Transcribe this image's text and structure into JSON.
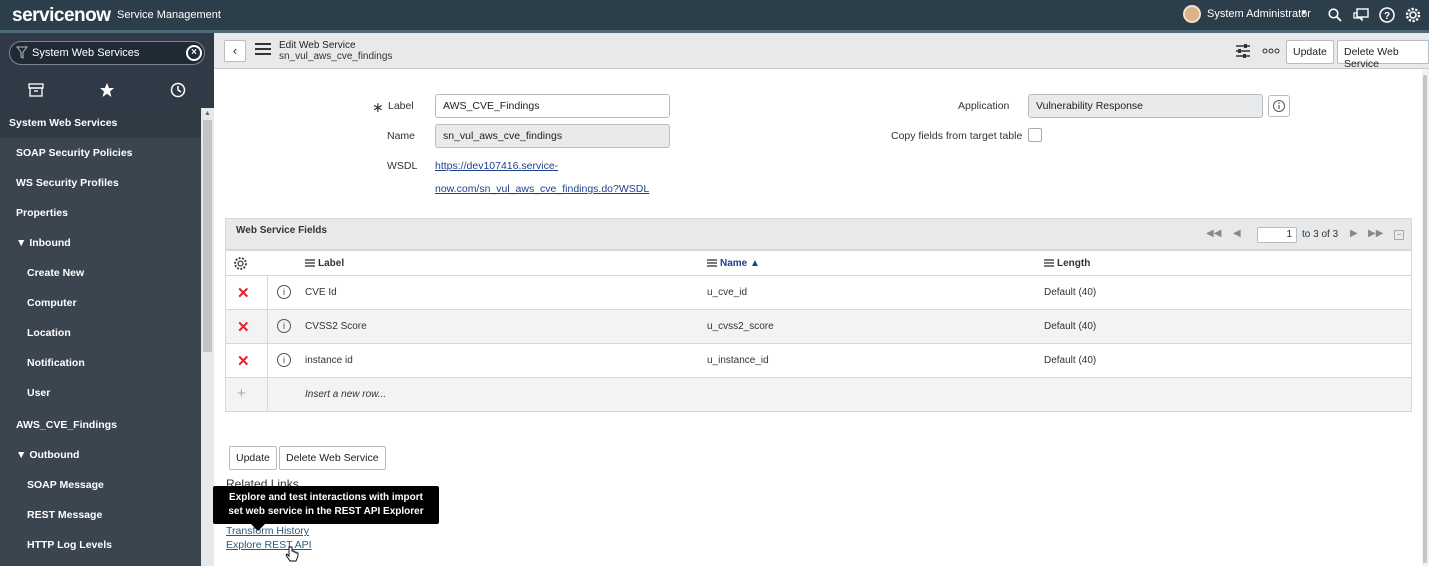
{
  "banner": {
    "logo_text": "servicenow",
    "product": "Service Management",
    "user_name": "System Administrator",
    "icons": [
      "search-icon",
      "chat-icon",
      "help-icon",
      "gear-icon"
    ]
  },
  "sidebar": {
    "filter_value": "System Web Services",
    "tabs": [
      "archive-icon",
      "star-icon",
      "history-icon"
    ],
    "items": [
      {
        "label": "System Web Services",
        "type": "header"
      },
      {
        "label": "SOAP Security Policies",
        "type": "item"
      },
      {
        "label": "WS Security Profiles",
        "type": "item"
      },
      {
        "label": "Properties",
        "type": "item"
      },
      {
        "label": "Inbound",
        "type": "section"
      },
      {
        "label": "Create New",
        "type": "subitem"
      },
      {
        "label": "Computer",
        "type": "subitem"
      },
      {
        "label": "Location",
        "type": "subitem"
      },
      {
        "label": "Notification",
        "type": "subitem"
      },
      {
        "label": "User",
        "type": "subitem"
      },
      {
        "label": "AWS_CVE_Findings",
        "type": "item"
      },
      {
        "label": "Outbound",
        "type": "section"
      },
      {
        "label": "SOAP Message",
        "type": "subitem"
      },
      {
        "label": "REST Message",
        "type": "subitem"
      },
      {
        "label": "HTTP Log Levels",
        "type": "subitem"
      }
    ]
  },
  "header": {
    "title": "Edit Web Service",
    "subtitle": "sn_vul_aws_cve_findings",
    "update_label": "Update",
    "delete_label": "Delete Web Service"
  },
  "form": {
    "label_label": "Label",
    "label_value": "AWS_CVE_Findings",
    "name_label": "Name",
    "name_value": "sn_vul_aws_cve_findings",
    "wsdl_label": "WSDL",
    "wsdl_line1": "https://dev107416.service-",
    "wsdl_line2": "now.com/sn_vul_aws_cve_findings.do?WSDL",
    "application_label": "Application",
    "application_value": "Vulnerability Response",
    "copy_fields_label": "Copy fields from target table"
  },
  "related_list": {
    "title": "Web Service Fields",
    "page_value": "1",
    "page_text": "to 3 of 3",
    "columns": [
      "Label",
      "Name",
      "Length"
    ],
    "rows": [
      {
        "label": "CVE Id",
        "name": "u_cve_id",
        "length": "Default (40)"
      },
      {
        "label": "CVSS2 Score",
        "name": "u_cvss2_score",
        "length": "Default (40)"
      },
      {
        "label": "instance id",
        "name": "u_instance_id",
        "length": "Default (40)"
      }
    ],
    "insert_label": "Insert a new row..."
  },
  "footer": {
    "update_label": "Update",
    "delete_label": "Delete Web Service",
    "related_links_title": "Related Links",
    "link_transform": "Transform History",
    "link_explore": "Explore REST API",
    "tooltip": "Explore and test interactions with import set web service in the REST API Explorer"
  },
  "colors": {
    "banner": "#2d3e4b",
    "sidebar": "#303a46",
    "delete_x": "#e0252f",
    "link": "#1f3f8f"
  }
}
